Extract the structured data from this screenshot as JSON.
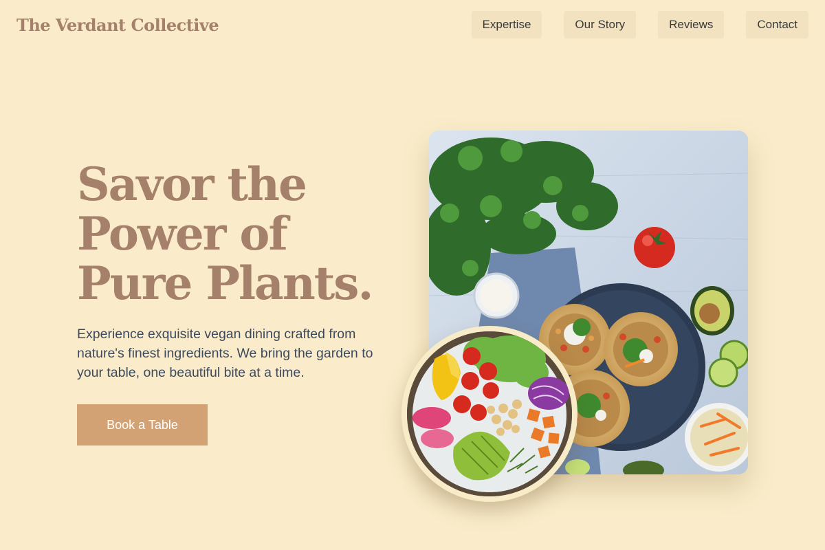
{
  "header": {
    "brand": "The Verdant Collective",
    "nav": [
      "Expertise",
      "Our Story",
      "Reviews",
      "Contact"
    ]
  },
  "hero": {
    "title_lines": [
      "Savor the",
      "Power of",
      "Pure Plants."
    ],
    "subtitle": "Experience exquisite vegan dining crafted from nature's finest ingredients. We bring the garden to your table, one beautiful bite at a time.",
    "cta": "Book a Table"
  },
  "images": {
    "main": "tostadas-table-photo",
    "bowl": "salad-bowl-photo"
  },
  "colors": {
    "background": "#faecca",
    "brand": "#a5806a",
    "nav_bg": "#f2e2bf",
    "cta_bg": "#d2a274",
    "body_text": "#3d4a5c"
  }
}
